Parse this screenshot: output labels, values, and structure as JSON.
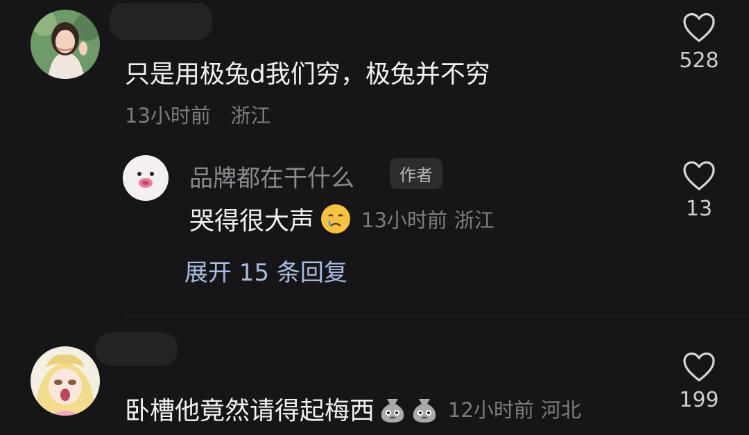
{
  "comments": [
    {
      "text": "只是用极兔d我们穷，极兔并不穷",
      "time": "13小时前",
      "location": "浙江",
      "likes": "528"
    },
    {
      "text": "卧槽他竟然请得起梅西",
      "time": "12小时前",
      "location": "河北",
      "likes": "199"
    }
  ],
  "reply": {
    "author": "品牌都在干什么",
    "badge": "作者",
    "text": "哭得很大声",
    "time": "13小时前",
    "location": "浙江",
    "likes": "13"
  },
  "expand_label": "展开 15 条回复",
  "icons": {
    "like": "heart-outline-icon",
    "crying": "crying-face-emoji",
    "money_bag": "money-bag-emoji"
  }
}
